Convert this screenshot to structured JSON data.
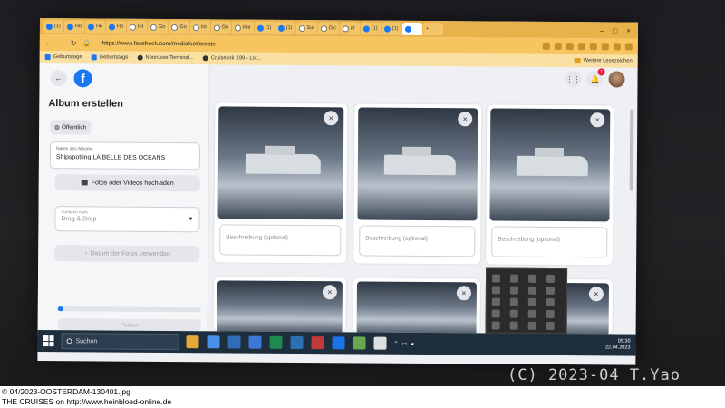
{
  "browser": {
    "tabs": [
      {
        "label": "(1)",
        "icon": "facebook-icon"
      },
      {
        "label": "Ho",
        "icon": "facebook-icon"
      },
      {
        "label": "Ho",
        "icon": "facebook-icon"
      },
      {
        "label": "Ho",
        "icon": "facebook-icon"
      },
      {
        "label": "Int",
        "icon": "page-icon"
      },
      {
        "label": "Go",
        "icon": "google-icon"
      },
      {
        "label": "Go",
        "icon": "google-icon"
      },
      {
        "label": "Int",
        "icon": "page-icon"
      },
      {
        "label": "Go",
        "icon": "google-icon"
      },
      {
        "label": "Kre",
        "icon": "page-icon"
      },
      {
        "label": "(1)",
        "icon": "facebook-icon"
      },
      {
        "label": "(1)",
        "icon": "facebook-icon"
      },
      {
        "label": "Sul",
        "icon": "page-icon"
      },
      {
        "label": "Glc",
        "icon": "page-icon"
      },
      {
        "label": "dr",
        "icon": "page-icon"
      },
      {
        "label": "(1)",
        "icon": "facebook-icon"
      },
      {
        "label": "(1)",
        "icon": "facebook-icon"
      },
      {
        "label": "",
        "icon": "facebook-icon",
        "active": true
      }
    ],
    "new_tab": "+",
    "url": "https://www.facebook.com/media/set/create",
    "bookmarks": [
      {
        "label": "Geburtstage",
        "icon": "facebook-icon"
      },
      {
        "label": "Geburtstage",
        "icon": "facebook-icon"
      },
      {
        "label": "Noordzee Terminal...",
        "icon": "globe-icon"
      },
      {
        "label": "Cruiselink X99 - Lot...",
        "icon": "globe-icon"
      }
    ],
    "other_bookmarks": "Weitere Lesezeichen"
  },
  "panel": {
    "album_title": "Album erstellen",
    "privacy_label": "Öffentlich",
    "album_name_label": "Name des Albums",
    "album_name_value": "Shipspotting LA BELLE DES OCÉANS",
    "upload_label": "Fotos oder Videos hochladen",
    "sort_label": "Sortieren nach",
    "sort_value": "Drag & Drop",
    "date_label": "Datum der Fotos verwenden",
    "post_label": "Posten",
    "progress": 0.04
  },
  "notifications_badge": "1",
  "cards": [
    {
      "desc_placeholder": "Beschreibung (optional)"
    },
    {
      "desc_placeholder": "Beschreibung (optional)"
    },
    {
      "desc_placeholder": "Beschreibung (optional)"
    }
  ],
  "taskbar": {
    "search_label": "Suchen",
    "time": "09:30",
    "date": "22.04.2023",
    "app_colors": [
      "#e8a93a",
      "#4a8fe7",
      "#2f6db8",
      "#3b78d8",
      "#1f8a50",
      "#2c6fb3",
      "#c03a3a",
      "#1a73e8",
      "#6aa84f",
      "#e0e0e0"
    ]
  },
  "watermark": "(C) 2023-04 T.Yao",
  "caption": {
    "line1": "© 04/2023-OOSTERDAM-130401.jpg",
    "line2": "THE CRUISES on http://www.heinbloed-online.de"
  }
}
